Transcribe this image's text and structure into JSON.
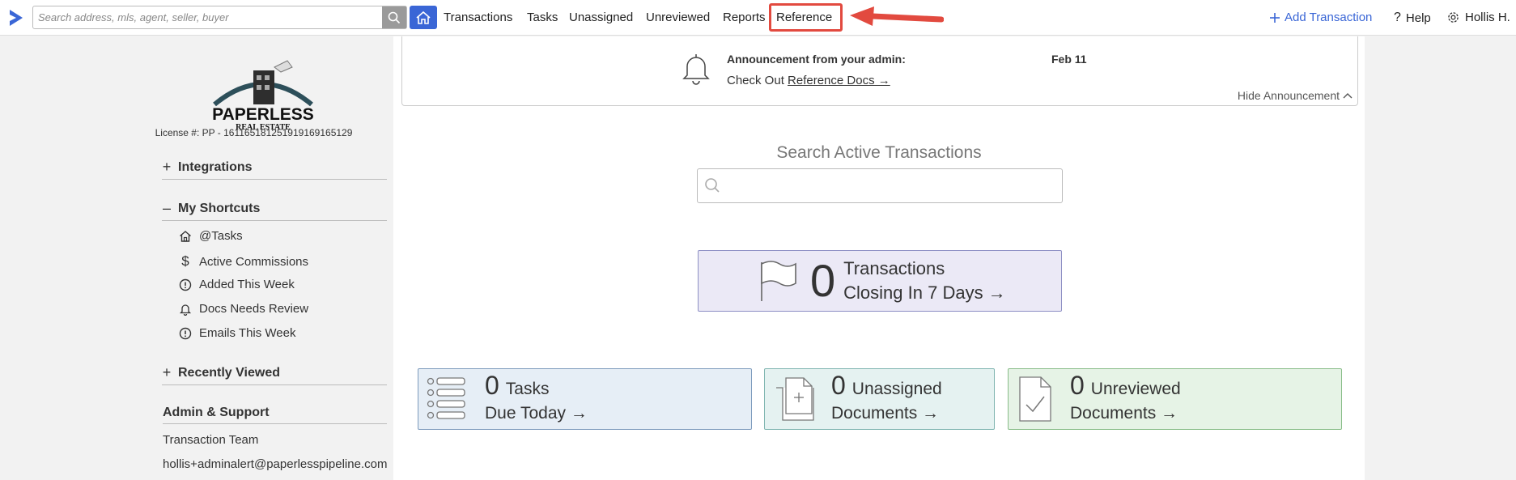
{
  "topbar": {
    "search_placeholder": "Search address, mls, agent, seller, buyer",
    "nav": [
      "Transactions",
      "Tasks",
      "Unassigned",
      "Unreviewed",
      "Reports",
      "Reference"
    ],
    "add_transaction": "Add Transaction",
    "help": "Help",
    "user": "Hollis H.",
    "accent_color": "#3a66d6",
    "highlight_color": "#e24a3f"
  },
  "sidebar": {
    "brand_name": "PAPERLESS",
    "brand_tag": "REAL ESTATE",
    "license": "License #: PP - 16116518125191916916512​9",
    "integrations": "Integrations",
    "my_shortcuts": "My Shortcuts",
    "shortcuts": [
      "@Tasks",
      "Active Commissions",
      "Added This Week",
      "Docs Needs Review",
      "Emails This Week"
    ],
    "recently_viewed": "Recently Viewed",
    "admin_support": "Admin & Support",
    "transaction_team": "Transaction Team",
    "admin_email": "hollis+adminalert@paperlesspipeline.com"
  },
  "announcement": {
    "from": "Announcement from your admin:",
    "date": "Feb 11",
    "message_prefix": "Check Out ",
    "link": "Reference Docs →",
    "hide": "Hide Announcement"
  },
  "main": {
    "search_title": "Search Active Transactions",
    "closing": {
      "count": "0",
      "line1": "Transactions",
      "line2": "Closing In 7 Days →"
    },
    "tasks": {
      "count": "0",
      "line1": "Tasks",
      "line2": "Due Today →"
    },
    "unassigned": {
      "count": "0",
      "line1": "Unassigned",
      "line2": "Documents →"
    },
    "unreviewed": {
      "count": "0",
      "line1": "Unreviewed",
      "line2": "Documents →"
    }
  }
}
